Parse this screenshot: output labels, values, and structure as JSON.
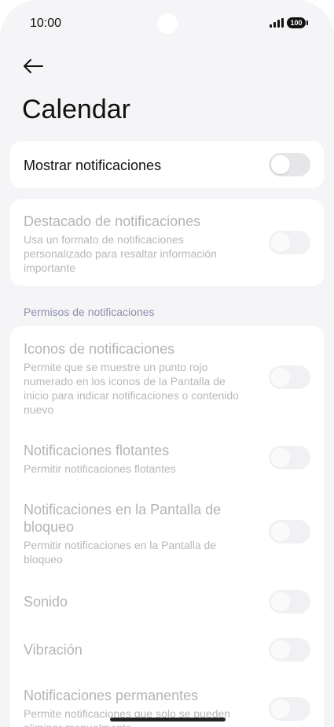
{
  "status_bar": {
    "time": "10:00",
    "battery": "100",
    "signal_icon": "signal-icon",
    "battery_icon": "battery-icon"
  },
  "header": {
    "back_icon": "back-arrow-icon",
    "title": "Calendar"
  },
  "main_toggle": {
    "label": "Mostrar notificaciones",
    "enabled": false
  },
  "highlight": {
    "title": "Destacado de notificaciones",
    "description": "Usa un formato de notificaciones personalizado para resaltar información importante",
    "enabled": false
  },
  "permissions": {
    "section_label": "Permisos de notificaciones",
    "items": [
      {
        "title": "Iconos de notificaciones",
        "description": "Permite que se muestre un punto rojo numerado en los iconos de la Pantalla de inicio para indicar notificaciones o contenido nuevo",
        "enabled": false
      },
      {
        "title": "Notificaciones flotantes",
        "description": "Permitir notificaciones flotantes",
        "enabled": false
      },
      {
        "title": "Notificaciones en la Pantalla de bloqueo",
        "description": "Permitir notificaciones en la Pantalla de bloqueo",
        "enabled": false
      },
      {
        "title": "Sonido",
        "description": "",
        "enabled": false
      },
      {
        "title": "Vibración",
        "description": "",
        "enabled": false
      },
      {
        "title": "Notificaciones permanentes",
        "description": "Permite notificaciones que solo se pueden eliminar manualmente",
        "enabled": false
      }
    ]
  },
  "colors": {
    "background": "#f5f5f7",
    "card": "#ffffff",
    "section_label": "#8c8fae",
    "disabled_text": "#b4b4b7"
  }
}
